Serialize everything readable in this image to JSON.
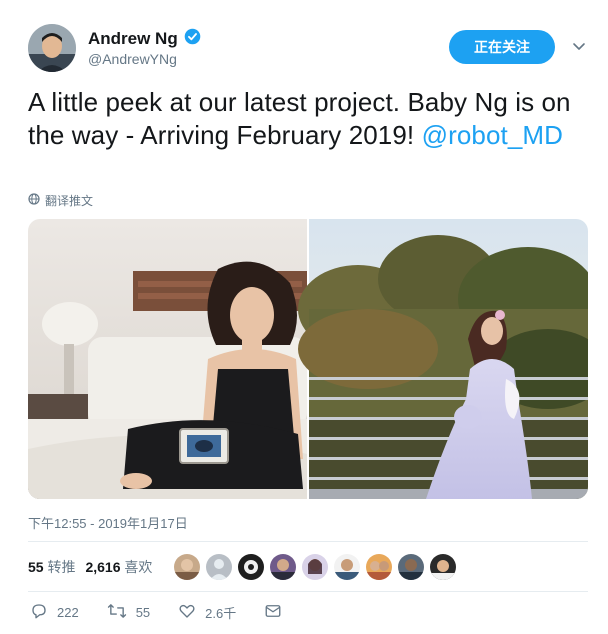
{
  "author": {
    "name": "Andrew Ng",
    "handle": "@AndrewYNg",
    "verified_icon": "verified-badge-icon"
  },
  "follow_button_label": "正在关注",
  "tweet": {
    "text_main": "A little peek at our latest project. Baby Ng is on the way - Arriving February 2019! ",
    "mention": "@robot_MD",
    "translate_label": "翻译推文"
  },
  "timestamp": "下午12:55 - 2019年1月17日",
  "stats": {
    "retweets_count": "55",
    "retweets_label": "转推",
    "likes_count": "2,616",
    "likes_label": "喜欢"
  },
  "actions": {
    "reply_count": "222",
    "retweet_count": "55",
    "like_count": "2.6千"
  },
  "colors": {
    "accent": "#1da1f2",
    "secondary_text": "#657786",
    "divider": "#e6ecf0"
  }
}
